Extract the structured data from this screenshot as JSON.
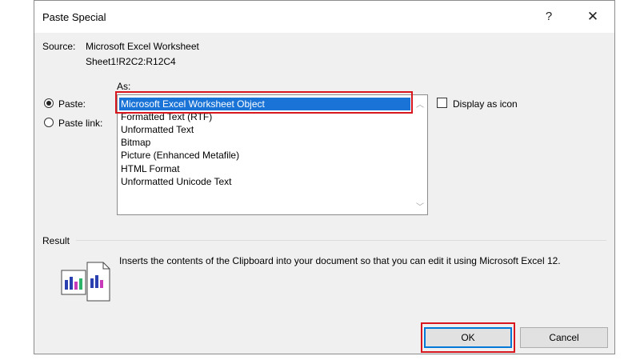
{
  "dialog": {
    "title": "Paste Special",
    "help": "?",
    "close": "✕"
  },
  "source": {
    "label": "Source:",
    "line1": "Microsoft Excel Worksheet",
    "line2": "Sheet1!R2C2:R12C4"
  },
  "as_label": "As:",
  "options": {
    "paste": "Paste:",
    "paste_link": "Paste link:",
    "selected": "paste"
  },
  "list": {
    "items": [
      "Microsoft Excel Worksheet Object",
      "Formatted Text (RTF)",
      "Unformatted Text",
      "Bitmap",
      "Picture (Enhanced Metafile)",
      "HTML Format",
      "Unformatted Unicode Text"
    ],
    "selected_index": 0
  },
  "display_as_icon": {
    "label": "Display as icon",
    "checked": false
  },
  "result": {
    "label": "Result",
    "text": "Inserts the contents of the Clipboard into your document so that you can edit it using Microsoft Excel 12."
  },
  "buttons": {
    "ok": "OK",
    "cancel": "Cancel"
  },
  "colors": {
    "selection": "#1a73d6",
    "highlight_box": "#d8161e"
  },
  "icons": {
    "help": "question-icon",
    "close": "close-icon",
    "result": "paste-object-icon"
  }
}
